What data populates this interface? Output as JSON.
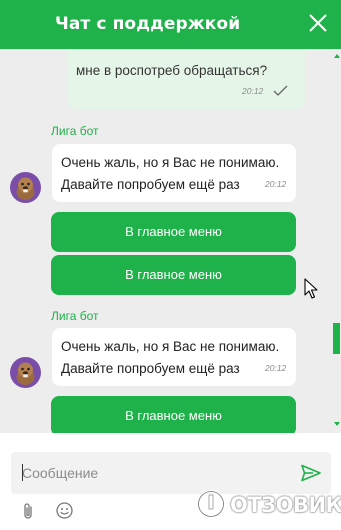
{
  "header": {
    "title": "Чат с поддержкой"
  },
  "user_message": {
    "text": "мне в роспотреб обращаться?",
    "time": "20:12"
  },
  "bot_messages": [
    {
      "sender": "Лига бот",
      "line1": "Очень жаль, но я Вас не понимаю.",
      "line2": "Давайте попробуем ещё раз",
      "time": "20:12"
    },
    {
      "sender": "Лига бот",
      "line1": "Очень жаль, но я Вас не понимаю.",
      "line2": "Давайте попробуем ещё раз",
      "time": "20:12"
    }
  ],
  "menu_buttons": [
    {
      "label": "В главное меню"
    },
    {
      "label": "В главное меню"
    },
    {
      "label": "В главное меню"
    }
  ],
  "composer": {
    "placeholder": "Сообщение"
  },
  "watermark": {
    "text": "ОТЗОВИК"
  },
  "colors": {
    "accent": "#1fb14a",
    "chat_bg": "#ededed",
    "user_bubble": "#e5f6e8"
  },
  "icons": [
    "close-icon",
    "check-icon",
    "bot-avatar",
    "send-icon",
    "attach-icon",
    "emoji-icon",
    "cursor-icon"
  ]
}
